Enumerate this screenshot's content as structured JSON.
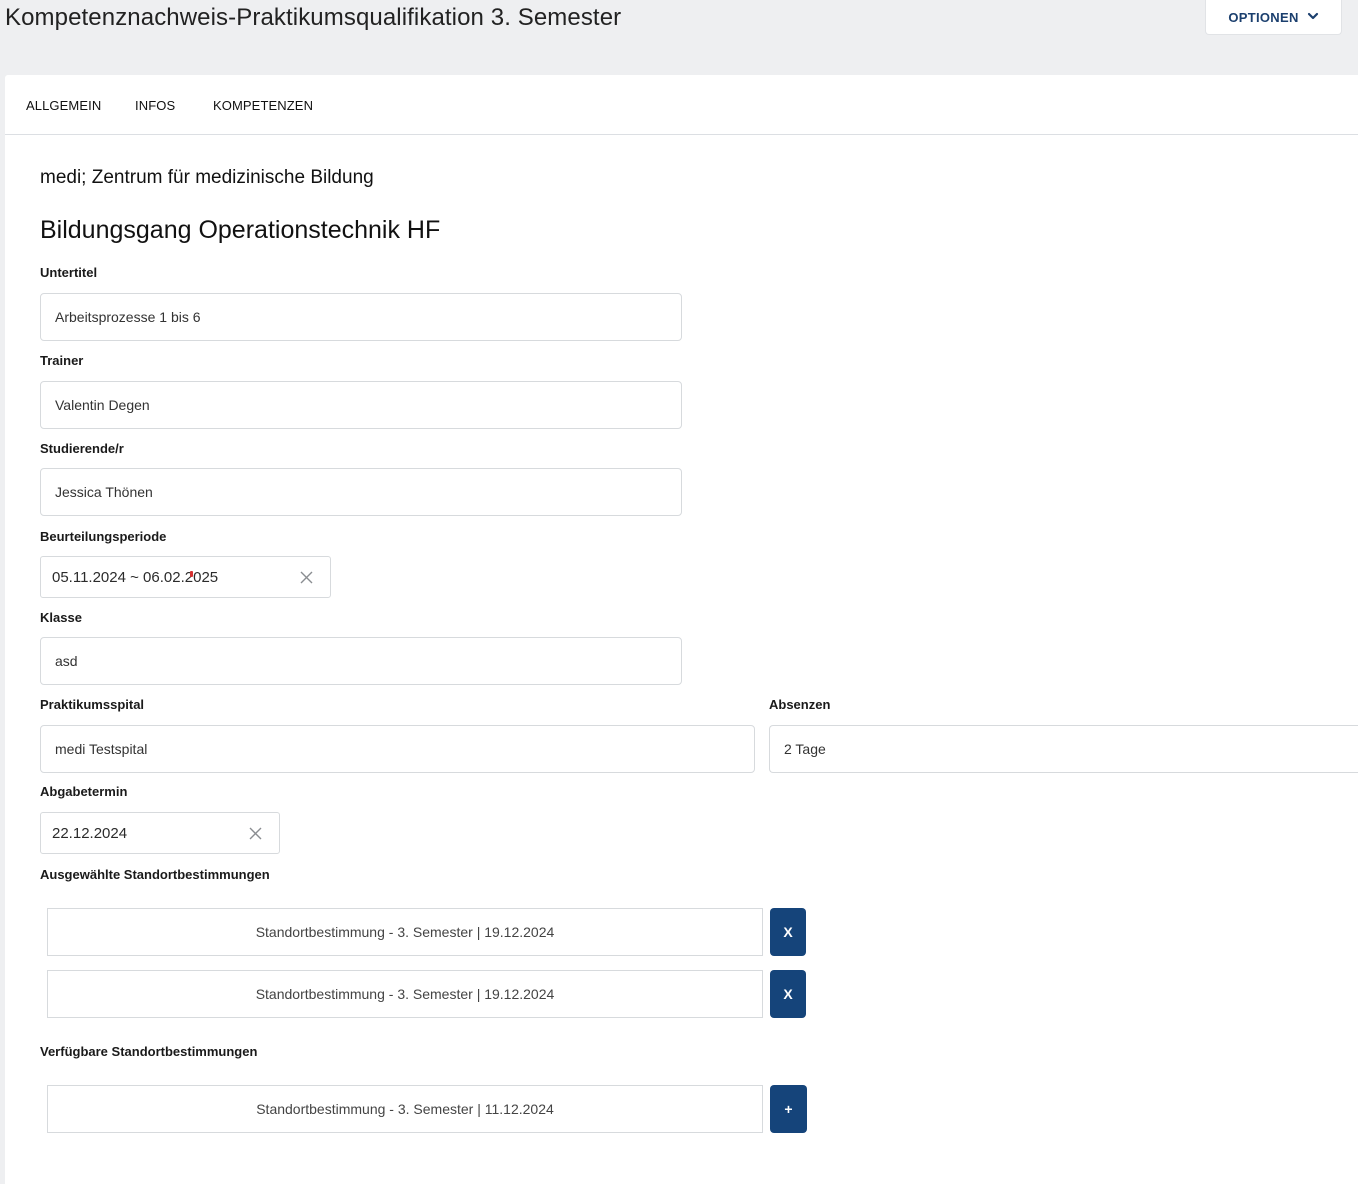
{
  "page": {
    "title": "Kompetenznachweis-Praktikumsqualifikation 3. Semester",
    "options_label": "OPTIONEN"
  },
  "tabs": [
    {
      "label": "ALLGEMEIN"
    },
    {
      "label": "INFOS"
    },
    {
      "label": "KOMPETENZEN"
    }
  ],
  "institution": "medi; Zentrum für medizinische Bildung",
  "program": "Bildungsgang Operationstechnik HF",
  "fields": {
    "untertitel": {
      "label": "Untertitel",
      "value": "Arbeitsprozesse 1 bis 6"
    },
    "trainer": {
      "label": "Trainer",
      "value": "Valentin Degen"
    },
    "studierende": {
      "label": "Studierende/r",
      "value": "Jessica Thönen"
    },
    "beurteilungsperiode": {
      "label": "Beurteilungsperiode",
      "value": "05.11.2024 ~ 06.02.2025"
    },
    "klasse": {
      "label": "Klasse",
      "value": "asd"
    },
    "praktikumsspital": {
      "label": "Praktikumsspital",
      "value": "medi Testspital"
    },
    "absenzen": {
      "label": "Absenzen",
      "value": "2 Tage"
    },
    "abgabetermin": {
      "label": "Abgabetermin",
      "value": "22.12.2024"
    }
  },
  "selected": {
    "label": "Ausgewählte Standortbestimmungen",
    "items": [
      {
        "text": "Standortbestimmung - 3. Semester | 19.12.2024",
        "button": "X"
      },
      {
        "text": "Standortbestimmung - 3. Semester | 19.12.2024",
        "button": "X"
      }
    ]
  },
  "available": {
    "label": "Verfügbare Standortbestimmungen",
    "items": [
      {
        "text": "Standortbestimmung - 3. Semester | 11.12.2024",
        "button": "+"
      }
    ]
  },
  "colors": {
    "primary": "#15447a",
    "background": "#eeeff1",
    "border": "#d7dadd"
  }
}
